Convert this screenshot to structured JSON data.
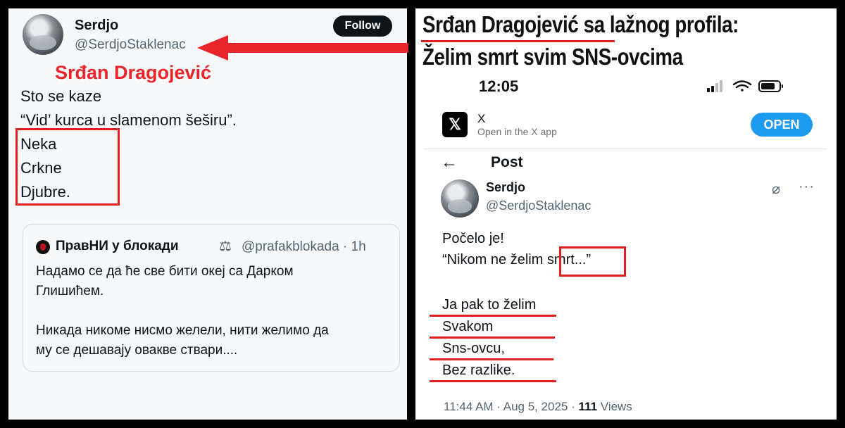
{
  "left_tweet": {
    "name": "Serdjo",
    "handle": "@SerdjoStaklenac",
    "follow_label": "Follow",
    "annotation_name": "Srđan Dragojević",
    "lines": [
      "Sto se kaze",
      "“Vid’ kurca u slamenom šeširu”.",
      "Neka",
      "Crkne",
      "Djubre."
    ],
    "quoted": {
      "name": "ПравНИ у блокади",
      "scale_icon": "⚖",
      "handle_time": "@prafakblokada · 1h",
      "lines": [
        "Надамо се да ће све бити океј са Дарком",
        "Глишићем.",
        "Никада никоме нисмо желели, нити желимо да",
        "му се дешавају овакве ствари...."
      ]
    }
  },
  "headline": {
    "line1_name": "Srđan Dragojević",
    "line1_rest": " sa lažnog profila:",
    "line2": "Želim smrt svim SNS-ovcima"
  },
  "phone": {
    "time": "12:05",
    "app_name": "X",
    "app_subtitle": "Open in the X app",
    "open_label": "OPEN",
    "page_title": "Post",
    "name": "Serdjo",
    "handle": "@SerdjoStaklenac",
    "lines": [
      "Počelo je!",
      "“Nikom ne želim smrt...”",
      "Ja pak to želim",
      "Svakom",
      "Sns-ovcu,",
      "Bez razlike."
    ],
    "meta_prefix": "11:44 AM · Aug 5, 2025 · ",
    "views_count": "111",
    "views_label": " Views"
  },
  "colors": {
    "annotation_red": "#e02020",
    "follow_bg": "#0f1419",
    "open_blue": "#1d9bf0"
  },
  "icons": [
    "back-arrow-icon",
    "grok-icon",
    "more-icon",
    "x-logo-icon",
    "scale-icon",
    "signal-icon",
    "wifi-icon",
    "battery-icon"
  ]
}
